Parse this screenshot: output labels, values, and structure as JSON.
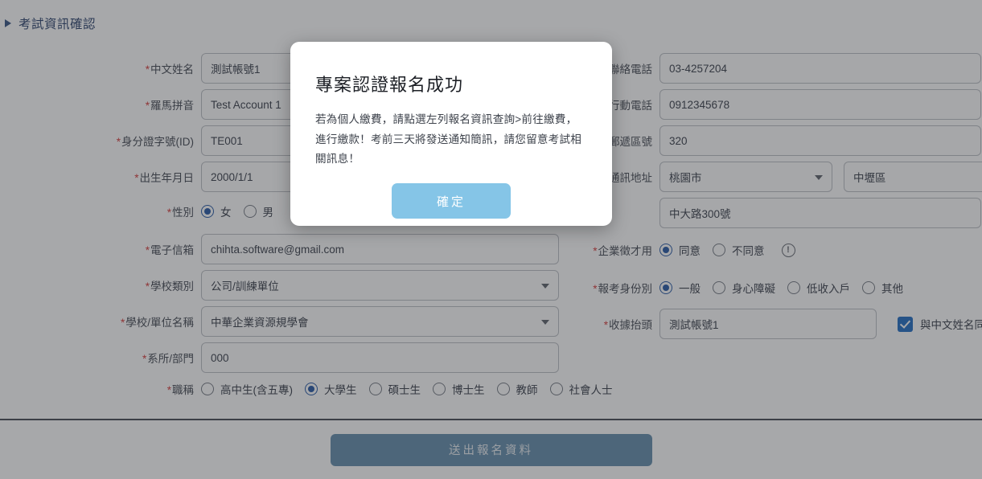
{
  "section": {
    "title": "考試資訊確認",
    "icon": "triangle-right-icon"
  },
  "colors": {
    "header_text": "#1f3864",
    "required_mark": "#d32f2f",
    "radio_selected": "#1a4fa0",
    "checkbox": "#1565c0",
    "modal_button": "#85c5e7",
    "submit_button": "#5b87a8",
    "overlay": "rgba(60,62,66,0.45)"
  },
  "left_fields": {
    "chinese_name": {
      "label": "中文姓名",
      "required": true,
      "value": "測試帳號1"
    },
    "romanization": {
      "label": "羅馬拼音",
      "required": true,
      "value": "Test Account 1"
    },
    "id_number": {
      "label": "身分證字號(ID)",
      "required": true,
      "value": "TE001"
    },
    "birth_date": {
      "label": "出生年月日",
      "required": true,
      "value": "2000/1/1"
    },
    "gender": {
      "label": "性別",
      "required": true,
      "options": [
        {
          "label": "女",
          "selected": true
        },
        {
          "label": "男",
          "selected": false
        }
      ]
    },
    "email": {
      "label": "電子信箱",
      "required": true,
      "value": "chihta.software@gmail.com"
    },
    "school_type": {
      "label": "學校類別",
      "required": true,
      "value": "公司/訓練單位",
      "type": "select"
    },
    "school_name": {
      "label": "學校/單位名稱",
      "required": true,
      "value": "中華企業資源規學會",
      "type": "select"
    },
    "department": {
      "label": "系所/部門",
      "required": true,
      "value": "000"
    },
    "job_title": {
      "label": "職稱",
      "required": true,
      "options": [
        {
          "label": "高中生(含五專)",
          "selected": false
        },
        {
          "label": "大學生",
          "selected": true
        },
        {
          "label": "碩士生",
          "selected": false
        },
        {
          "label": "博士生",
          "selected": false
        },
        {
          "label": "教師",
          "selected": false
        },
        {
          "label": "社會人士",
          "selected": false
        }
      ]
    }
  },
  "right_fields": {
    "contact_phone": {
      "label": "聯絡電話",
      "required": true,
      "value": "03-4257204"
    },
    "mobile_phone": {
      "label": "行動電話",
      "required": true,
      "value": "0912345678"
    },
    "postal_code": {
      "label": "郵遞區號",
      "required": true,
      "value": "320"
    },
    "address": {
      "label": "通訊地址",
      "required": true,
      "city": "桃園市",
      "district": "中壢區",
      "street": "中大路300號"
    },
    "corporate_recruit": {
      "label": "企業徵才用",
      "required": true,
      "options": [
        {
          "label": "同意",
          "selected": true
        },
        {
          "label": "不同意",
          "selected": false
        }
      ],
      "info_icon": "!"
    },
    "applicant_type": {
      "label": "報考身份別",
      "required": true,
      "options": [
        {
          "label": "一般",
          "selected": true
        },
        {
          "label": "身心障礙",
          "selected": false
        },
        {
          "label": "低收入戶",
          "selected": false
        },
        {
          "label": "其他",
          "selected": false
        }
      ]
    },
    "receipt_title": {
      "label": "收據抬頭",
      "required": true,
      "value": "測試帳號1",
      "same_as_name_label": "與中文姓名同",
      "same_as_name_checked": true
    }
  },
  "submit": {
    "label": "送出報名資料"
  },
  "modal": {
    "title": "專案認證報名成功",
    "body": "若為個人繳費，請點選左列報名資訊查詢>前往繳費，進行繳款！考前三天將發送通知簡訊，請您留意考試相關訊息！",
    "confirm_label": "確定"
  }
}
